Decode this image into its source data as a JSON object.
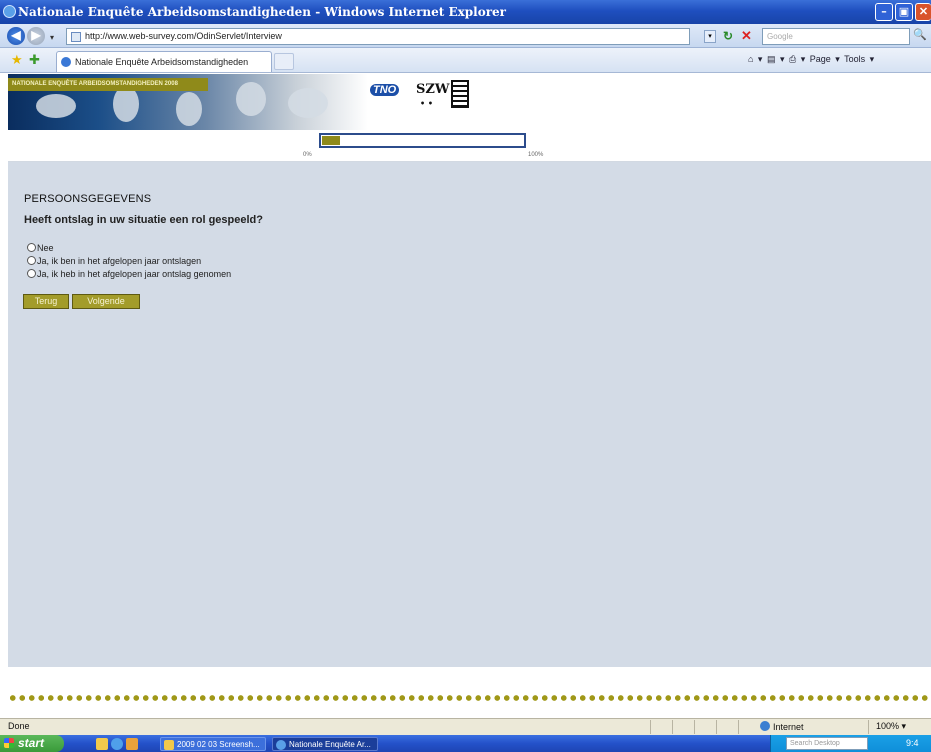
{
  "window": {
    "title": "Nationale Enquête Arbeidsomstandigheden - Windows Internet Explorer",
    "minimize": "–",
    "maximize": "▣",
    "close": "✕"
  },
  "addressbar": {
    "back": "◀",
    "forward": "▶",
    "dropdown": "▾",
    "url": "http://www.web-survey.com/OdinServlet/Interview",
    "url_dropdown": "▾",
    "refresh": "↻",
    "stop": "✕",
    "search_placeholder": "Google",
    "search_button": "🔍"
  },
  "tabs": {
    "active_tab": "Nationale Enquête Arbeidsomstandigheden",
    "favorites_icon": "★",
    "add_favorites_icon": "✚"
  },
  "commandbar": {
    "items": [
      "⌂ ▾",
      "▤ ▾",
      "⎙ ▾",
      "Page ▾",
      "Tools ▾"
    ]
  },
  "header": {
    "banner_tag": "NATIONALE ENQUÊTE ARBEIDSOMSTANDIGHEDEN 2008",
    "logo_tno": "TNO",
    "logo_szw": "SZW",
    "logo_szw_sub": "• •"
  },
  "progress": {
    "value_percent": 9,
    "label_start": "0%",
    "label_end": "100%"
  },
  "survey": {
    "section_title": "PERSOONSGEGEVENS",
    "question": "Heeft ontslag in uw situatie een rol gespeeld?",
    "options": [
      "Nee",
      "Ja, ik ben in het afgelopen jaar ontslagen",
      "Ja, ik heb in het afgelopen jaar ontslag genomen"
    ],
    "back_label": "Terug",
    "next_label": "Volgende"
  },
  "status": {
    "text": "Done",
    "zone": "Internet",
    "zoom": "100% ▾"
  },
  "taskbar": {
    "start_label": "start",
    "task1": "2009 02 03 Screensh...",
    "task2": "Nationale Enquête Ar...",
    "desktop_search_placeholder": "Search Desktop",
    "clock": "9:4"
  },
  "colors": {
    "accent_olive": "#a39c2a",
    "content_bg": "#d3dbe6",
    "progress_border": "#2c4c8c"
  }
}
